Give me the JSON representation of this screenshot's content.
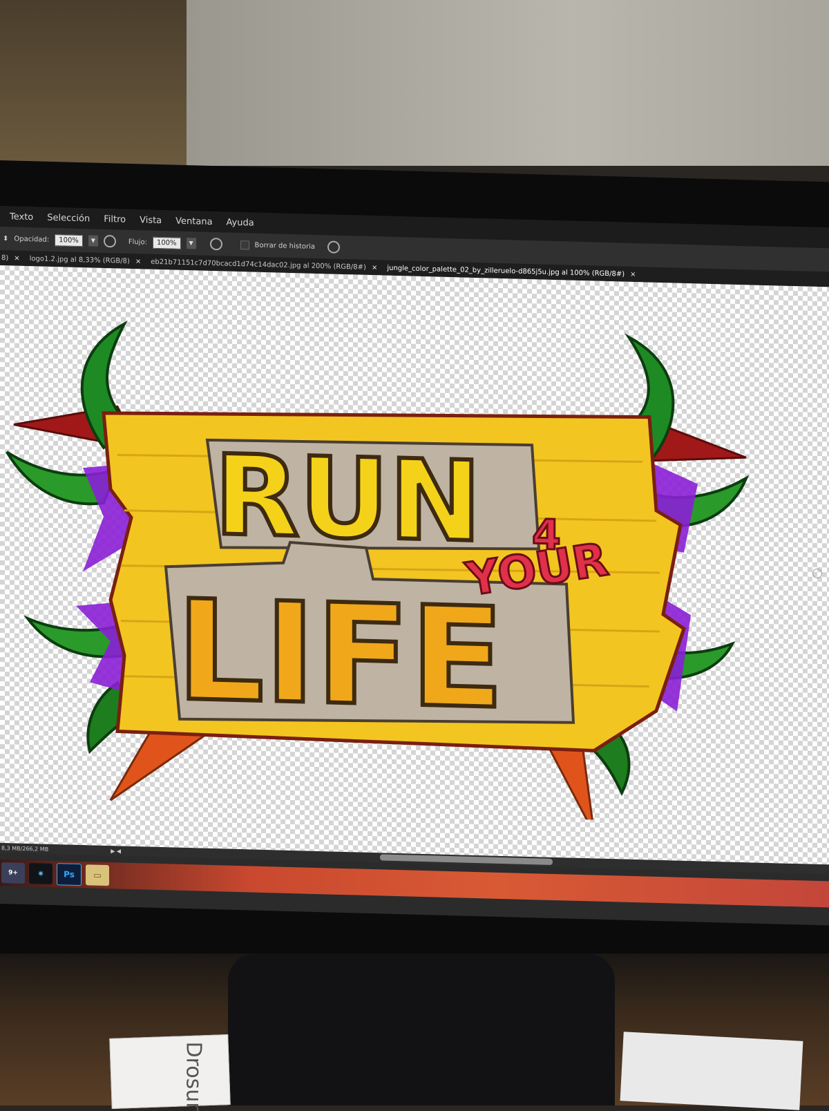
{
  "menu": [
    "Texto",
    "Selección",
    "Filtro",
    "Vista",
    "Ventana",
    "Ayuda"
  ],
  "options": {
    "opacity_label": "Opacidad:",
    "opacity_value": "100%",
    "flow_label": "Flujo:",
    "flow_value": "100%",
    "history_label": "Borrar de historia"
  },
  "tabs": [
    {
      "label": "8)"
    },
    {
      "label": "logo1.2.jpg al 8,33% (RGB/8)"
    },
    {
      "label": "eb21b71151c7d70bcacd1d74c14dac02.jpg al 200% (RGB/8#)"
    },
    {
      "label": "jungle_color_palette_02_by_zilleruelo-d865j5u.jpg al 100% (RGB/8#)"
    }
  ],
  "tab_close": "×",
  "status": {
    "doc_size": "8,3 MB/266,2 MB",
    "nav": "▶ ◀"
  },
  "logo": {
    "run": "RUN",
    "four": "4",
    "your": "YOUR",
    "life": "LIFE"
  },
  "taskbar": {
    "discord_badge": "9+",
    "ps": "Ps"
  },
  "desk": {
    "box_text": "Drosur"
  },
  "colors": {
    "sign": "#f2c521",
    "leaf": "#1e7d1e",
    "purple": "#8a1fd6",
    "red": "#e0304a"
  }
}
